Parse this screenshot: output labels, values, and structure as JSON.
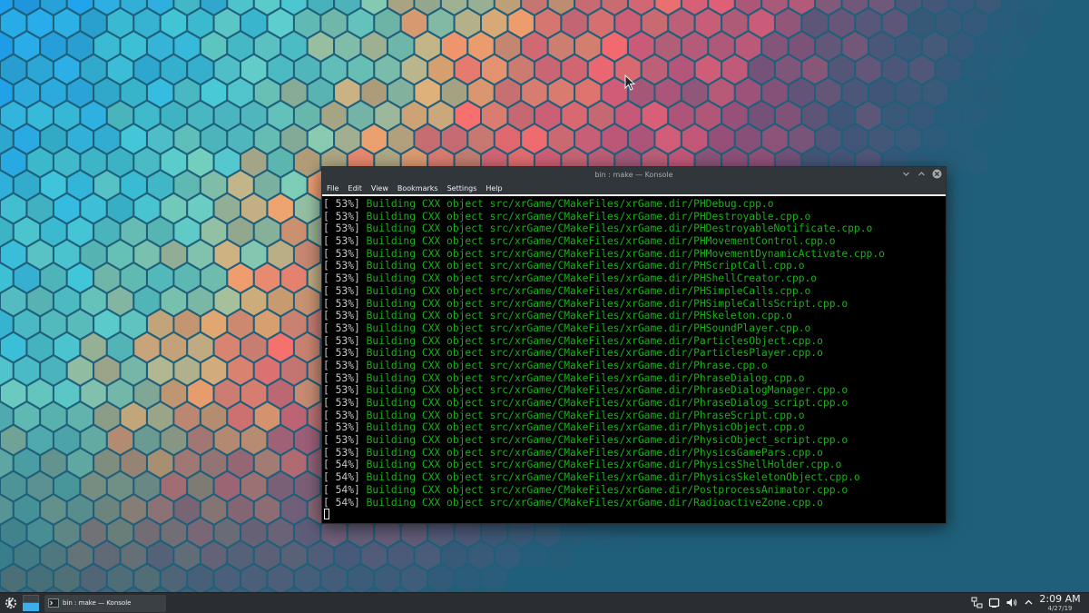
{
  "window": {
    "title": "bin : make — Konsole",
    "menu": [
      "File",
      "Edit",
      "View",
      "Bookmarks",
      "Settings",
      "Help"
    ]
  },
  "terminal": {
    "lines": [
      {
        "pct": "[ 53%]",
        "msg": "Building CXX object src/xrGame/CMakeFiles/xrGame.dir/PHDebug.cpp.o"
      },
      {
        "pct": "[ 53%]",
        "msg": "Building CXX object src/xrGame/CMakeFiles/xrGame.dir/PHDestroyable.cpp.o"
      },
      {
        "pct": "[ 53%]",
        "msg": "Building CXX object src/xrGame/CMakeFiles/xrGame.dir/PHDestroyableNotificate.cpp.o"
      },
      {
        "pct": "[ 53%]",
        "msg": "Building CXX object src/xrGame/CMakeFiles/xrGame.dir/PHMovementControl.cpp.o"
      },
      {
        "pct": "[ 53%]",
        "msg": "Building CXX object src/xrGame/CMakeFiles/xrGame.dir/PHMovementDynamicActivate.cpp.o"
      },
      {
        "pct": "[ 53%]",
        "msg": "Building CXX object src/xrGame/CMakeFiles/xrGame.dir/PHScriptCall.cpp.o"
      },
      {
        "pct": "[ 53%]",
        "msg": "Building CXX object src/xrGame/CMakeFiles/xrGame.dir/PHShellCreator.cpp.o"
      },
      {
        "pct": "[ 53%]",
        "msg": "Building CXX object src/xrGame/CMakeFiles/xrGame.dir/PHSimpleCalls.cpp.o"
      },
      {
        "pct": "[ 53%]",
        "msg": "Building CXX object src/xrGame/CMakeFiles/xrGame.dir/PHSimpleCallsScript.cpp.o"
      },
      {
        "pct": "[ 53%]",
        "msg": "Building CXX object src/xrGame/CMakeFiles/xrGame.dir/PHSkeleton.cpp.o"
      },
      {
        "pct": "[ 53%]",
        "msg": "Building CXX object src/xrGame/CMakeFiles/xrGame.dir/PHSoundPlayer.cpp.o"
      },
      {
        "pct": "[ 53%]",
        "msg": "Building CXX object src/xrGame/CMakeFiles/xrGame.dir/ParticlesObject.cpp.o"
      },
      {
        "pct": "[ 53%]",
        "msg": "Building CXX object src/xrGame/CMakeFiles/xrGame.dir/ParticlesPlayer.cpp.o"
      },
      {
        "pct": "[ 53%]",
        "msg": "Building CXX object src/xrGame/CMakeFiles/xrGame.dir/Phrase.cpp.o"
      },
      {
        "pct": "[ 53%]",
        "msg": "Building CXX object src/xrGame/CMakeFiles/xrGame.dir/PhraseDialog.cpp.o"
      },
      {
        "pct": "[ 53%]",
        "msg": "Building CXX object src/xrGame/CMakeFiles/xrGame.dir/PhraseDialogManager.cpp.o"
      },
      {
        "pct": "[ 53%]",
        "msg": "Building CXX object src/xrGame/CMakeFiles/xrGame.dir/PhraseDialog_script.cpp.o"
      },
      {
        "pct": "[ 53%]",
        "msg": "Building CXX object src/xrGame/CMakeFiles/xrGame.dir/PhraseScript.cpp.o"
      },
      {
        "pct": "[ 53%]",
        "msg": "Building CXX object src/xrGame/CMakeFiles/xrGame.dir/PhysicObject.cpp.o"
      },
      {
        "pct": "[ 53%]",
        "msg": "Building CXX object src/xrGame/CMakeFiles/xrGame.dir/PhysicObject_script.cpp.o"
      },
      {
        "pct": "[ 53%]",
        "msg": "Building CXX object src/xrGame/CMakeFiles/xrGame.dir/PhysicsGamePars.cpp.o"
      },
      {
        "pct": "[ 54%]",
        "msg": "Building CXX object src/xrGame/CMakeFiles/xrGame.dir/PhysicsShellHolder.cpp.o"
      },
      {
        "pct": "[ 54%]",
        "msg": "Building CXX object src/xrGame/CMakeFiles/xrGame.dir/PhysicsSkeletonObject.cpp.o"
      },
      {
        "pct": "[ 54%]",
        "msg": "Building CXX object src/xrGame/CMakeFiles/xrGame.dir/PostprocessAnimator.cpp.o"
      },
      {
        "pct": "[ 54%]",
        "msg": "Building CXX object src/xrGame/CMakeFiles/xrGame.dir/RadioactiveZone.cpp.o"
      }
    ]
  },
  "panel": {
    "launcher_icon": "kde-logo-icon",
    "task_label": "bin : make — Konsole",
    "clock_time": "2:09 AM",
    "clock_date": "4/27/19"
  },
  "colors": {
    "accent": "#3daee9",
    "terminal_text": "#18b218",
    "desktop_bg": "#1f5f7a"
  }
}
